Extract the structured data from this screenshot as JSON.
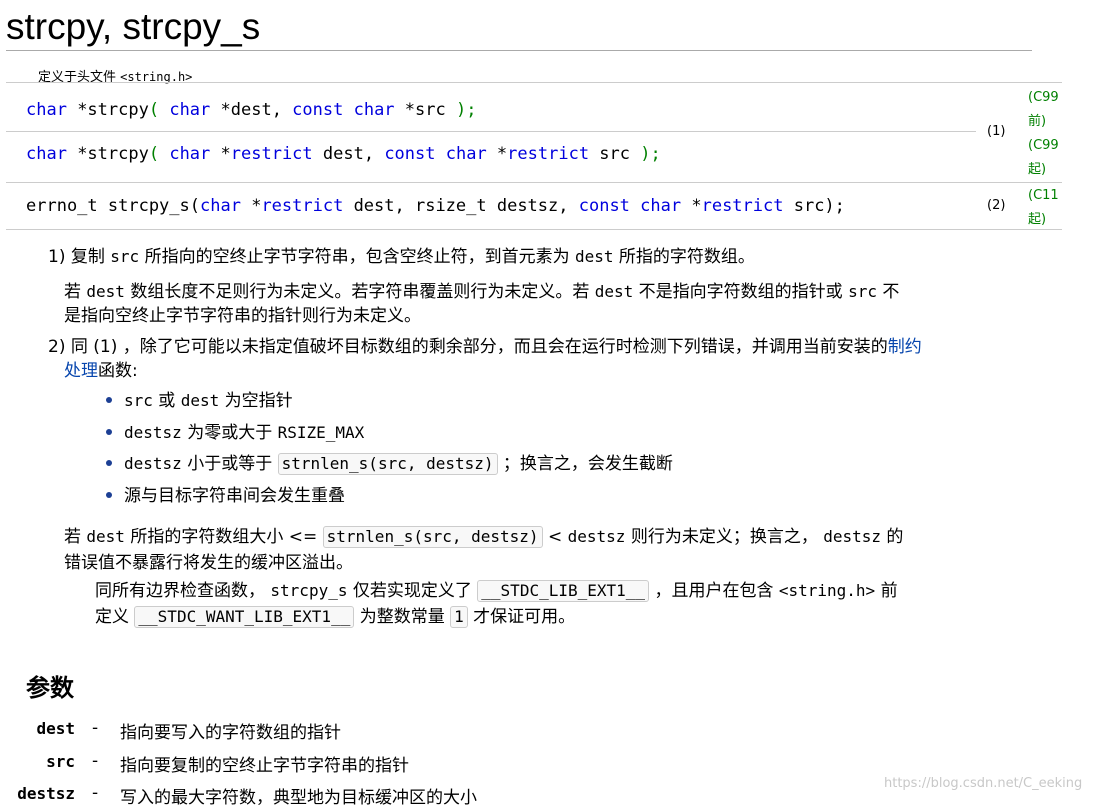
{
  "title": "strcpy, strcpy_s",
  "header": {
    "prefix": "定义于头文件 ",
    "file": "<string.h>"
  },
  "decls": {
    "d1": {
      "kw1": "char",
      "t1": " *strcpy",
      "p1": "(",
      "kw2": " char",
      "t2": " *dest, ",
      "kw3": "const",
      "kw4": " char",
      "t3": " *src ",
      "p2": ");"
    },
    "d2": {
      "kw1": "char",
      "t1": " *strcpy",
      "p1": "(",
      "kw2": " char",
      "t2": " *",
      "kw3": "restrict",
      "t3": " dest, ",
      "kw4": "const",
      "kw5": " char",
      "t4": " *",
      "kw6": "restrict",
      "t5": " src ",
      "p2": ");"
    },
    "d3": {
      "t0": "errno_t strcpy_s(",
      "kw1": "char",
      "t1": " *",
      "kw2": "restrict",
      "t2": " dest, rsize_t destsz, ",
      "kw3": "const",
      "kw4": " char",
      "t3": " *",
      "kw5": "restrict",
      "t4": " src);"
    }
  },
  "marks": {
    "m1": "(1)",
    "m2": "(2)"
  },
  "standards": {
    "s1a": "(C99",
    "s1b": "前)",
    "s2a": "(C99",
    "s2b": "起)",
    "s3a": "(C11",
    "s3b": "起)"
  },
  "body": {
    "p1": {
      "a": "1) 复制 ",
      "c1": "src",
      "b": " 所指向的空终止字节字符串，包含空终止符，到首元素为 ",
      "c2": "dest",
      "d": " 所指的字符数组。"
    },
    "p2": {
      "a": " 若 ",
      "c1": "dest",
      "b": " 数组长度不足则行为未定义。若字符串覆盖则行为未定义。若 ",
      "c2": "dest",
      "d": " 不是指向字符数组的指针或 ",
      "c3": "src",
      "e": " 不",
      "f": "是指向空终止字节字符串的指针则行为未定义。"
    },
    "p3": {
      "a": "2) 同 (1) ，除了它可能以未指定值破坏目标数组的剩余部分，而且会在运行时检测下列错误，并调用当前安装的",
      "link1": "制约",
      "link2": "处理",
      "b": "函数:"
    },
    "bullets": {
      "b1": {
        "c1": "src",
        "a": " 或 ",
        "c2": "dest",
        "b": " 为空指针"
      },
      "b2": {
        "c1": "destsz",
        "a": " 为零或大于 ",
        "c2": "RSIZE_MAX"
      },
      "b3": {
        "c1": "destsz",
        "a": " 小于或等于 ",
        "box": "strnlen_s(src, destsz)",
        "b": " ；换言之，会发生截断"
      },
      "b4": {
        "a": "源与目标字符串间会发生重叠"
      }
    },
    "p4": {
      "a": " 若 ",
      "c1": "dest",
      "b": " 所指的字符数组大小 <= ",
      "box": "strnlen_s(src, destsz)",
      "d": " < ",
      "c2": "destsz",
      "e": " 则行为未定义；换言之， ",
      "c3": "destsz",
      "f": " 的",
      "g": "错误值不暴露行将发生的缓冲区溢出。"
    },
    "p5": {
      "a": "同所有边界检查函数， ",
      "c1": "strcpy_s",
      "b": " 仅若实现定义了 ",
      "box1": "__STDC_LIB_EXT1__",
      "d": " ，且用户在包含 ",
      "c2": "<string.h>",
      "e": " 前",
      "f": "定义 ",
      "box2": "__STDC_WANT_LIB_EXT1__",
      "g": " 为整数常量 ",
      "box3": "1",
      "h": " 才保证可用。"
    }
  },
  "params": {
    "heading": "参数",
    "items": [
      {
        "name": "dest",
        "dash": "-",
        "desc": "指向要写入的字符数组的指针"
      },
      {
        "name": "src",
        "dash": "-",
        "desc": "指向要复制的空终止字节字符串的指针"
      },
      {
        "name": "destsz",
        "dash": "-",
        "desc": "写入的最大字符数，典型地为目标缓冲区的大小"
      }
    ]
  },
  "watermark": "https://blog.csdn.net/C_eeking"
}
